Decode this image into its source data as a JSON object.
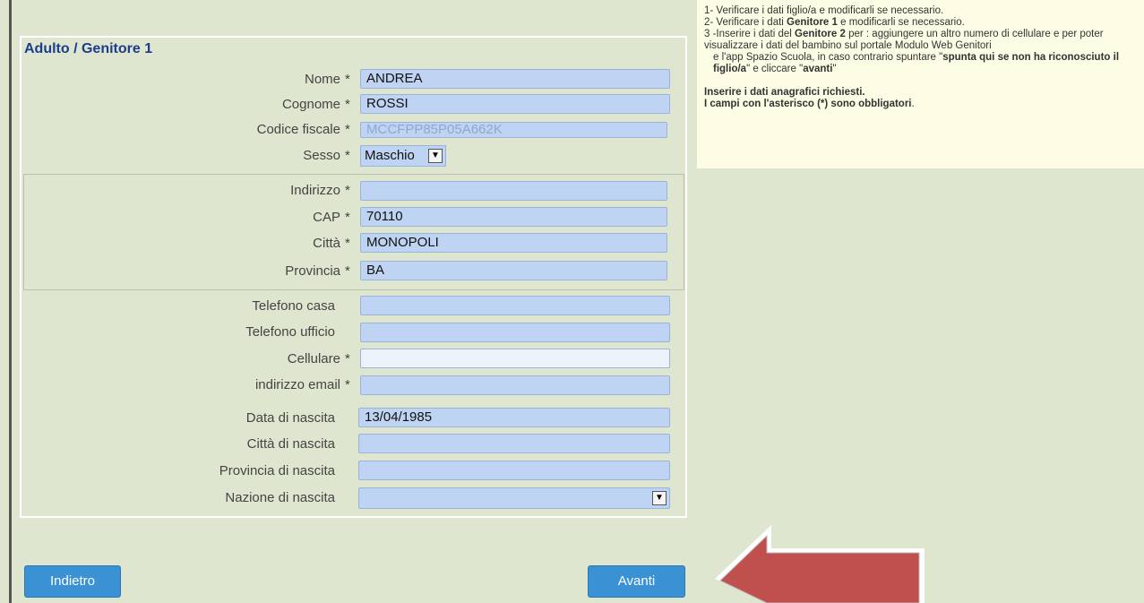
{
  "section_title": "Adulto / Genitore 1",
  "required_mark": "*",
  "fields": {
    "nome": {
      "label": "Nome",
      "value": "ANDREA"
    },
    "cognome": {
      "label": "Cognome",
      "value": "ROSSI"
    },
    "codice_fiscale": {
      "label": "Codice fiscale",
      "value": "MCCFPP85P05A662K"
    },
    "sesso": {
      "label": "Sesso",
      "value": "Maschio"
    },
    "indirizzo": {
      "label": "Indirizzo",
      "value": ""
    },
    "cap": {
      "label": "CAP",
      "value": "70110"
    },
    "citta": {
      "label": "Città",
      "value": "MONOPOLI"
    },
    "provincia": {
      "label": "Provincia",
      "value": "BA"
    },
    "telefono_casa": {
      "label": "Telefono casa",
      "value": ""
    },
    "telefono_ufficio": {
      "label": "Telefono ufficio",
      "value": ""
    },
    "cellulare": {
      "label": "Cellulare",
      "value": ""
    },
    "email": {
      "label": "indirizzo email",
      "value": ""
    },
    "data_nascita": {
      "label": "Data di nascita",
      "value": "13/04/1985"
    },
    "citta_nascita": {
      "label": "Città di nascita",
      "value": ""
    },
    "provincia_nascita": {
      "label": "Provincia di nascita",
      "value": ""
    },
    "nazione_nascita": {
      "label": "Nazione di nascita",
      "value": ""
    }
  },
  "info": {
    "line1": "1- Verificare i dati figlio/a e modificarli se necessario.",
    "line2_pre": "2- Verificare i dati ",
    "line2_bold": "Genitore 1",
    "line2_post": " e modificarli se necessario.",
    "line3_pre": "3 -Inserire i dati del ",
    "line3_bold": "Genitore 2",
    "line3_post": " per : aggiungere un altro numero di cellulare e per poter visualizzare i dati del bambino sul portale Modulo Web Genitori",
    "line4_pre": "e l'app Spazio Scuola, in caso contrario spuntare \"",
    "line4_bold": "spunta qui se non ha riconosciuto il figlio/a",
    "line4_mid": "\" e cliccare \"",
    "line4_bold2": "avanti",
    "line4_post": "\"",
    "line5": "Inserire i dati anagrafici richiesti.",
    "line6_pre": "I campi con l'asterisco (*) sono obbligatori",
    "line6_post": "."
  },
  "buttons": {
    "back": "Indietro",
    "next": "Avanti"
  },
  "colors": {
    "background": "#dfe6cf",
    "field": "#bfd3f2",
    "button": "#3a92d4",
    "arrow": "#c0504d",
    "title": "#1d3d8c"
  }
}
